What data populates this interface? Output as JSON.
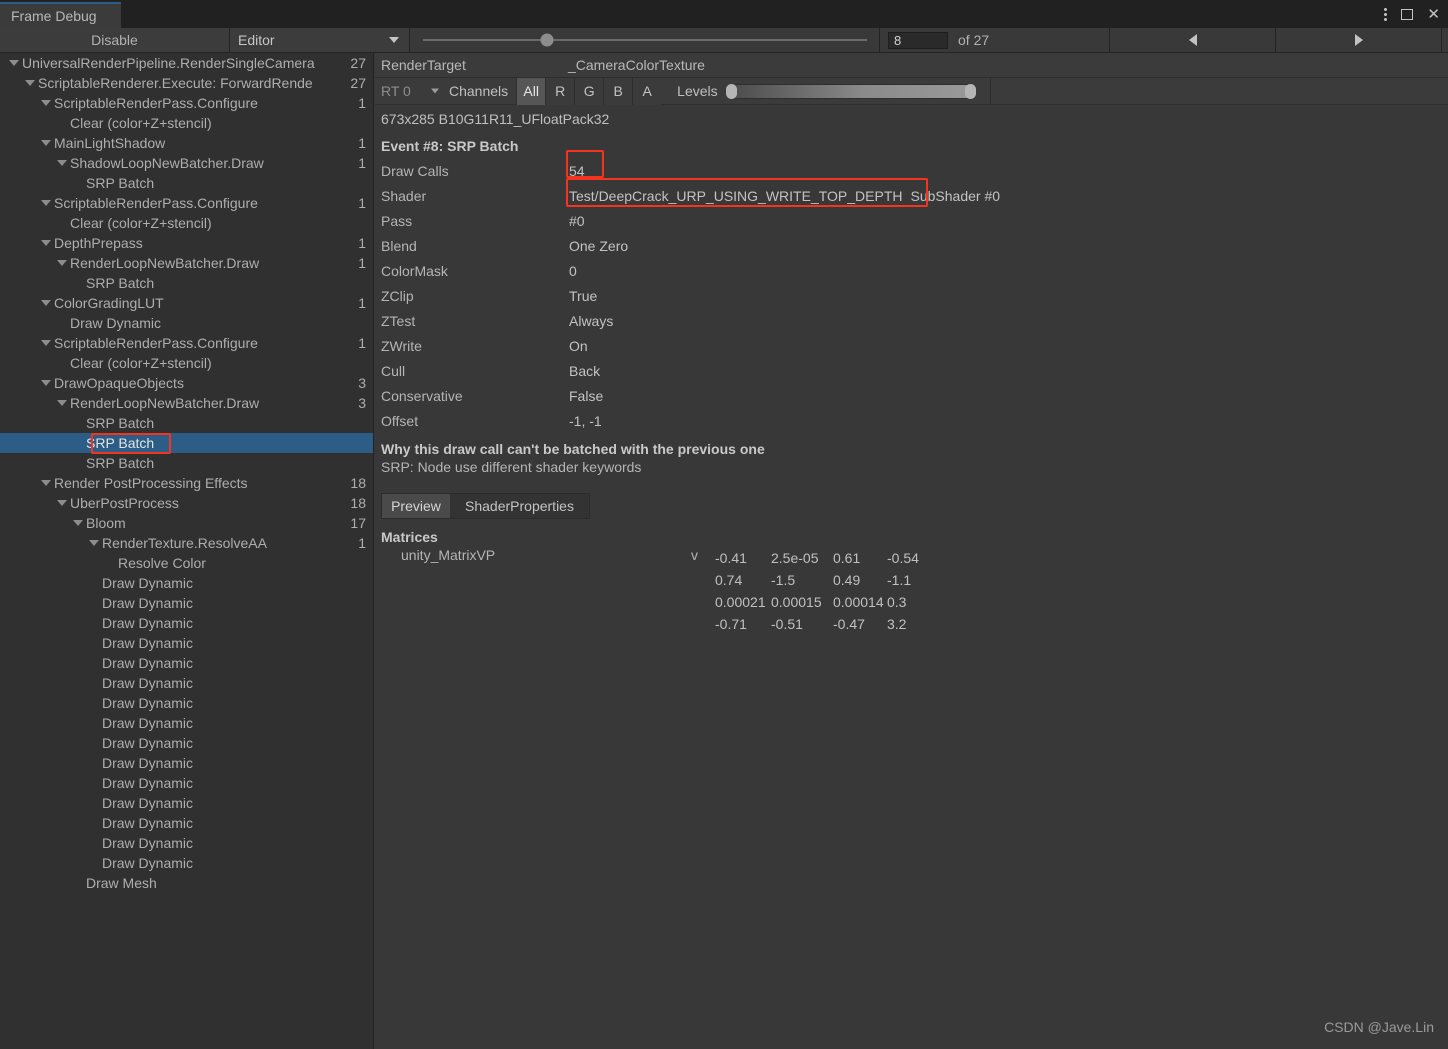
{
  "window": {
    "tab_title": "Frame Debug",
    "controls": {
      "menu": "kebab-icon",
      "maximize": "maximize-icon",
      "close": "✕"
    }
  },
  "toolbar": {
    "disable_label": "Disable",
    "target_dropdown": "Editor",
    "event_index": "8",
    "of_label": "of 27",
    "total_events": 27,
    "slider_percent": 28,
    "prev_label": "◀",
    "next_label": "▶"
  },
  "tree": {
    "rows": [
      {
        "label": "UniversalRenderPipeline.RenderSingleCamera",
        "depth": 0,
        "arrow": true,
        "count": "27"
      },
      {
        "label": "ScriptableRenderer.Execute: ForwardRende",
        "depth": 1,
        "arrow": true,
        "count": "27"
      },
      {
        "label": "ScriptableRenderPass.Configure",
        "depth": 2,
        "arrow": true,
        "count": "1"
      },
      {
        "label": "Clear (color+Z+stencil)",
        "depth": 3,
        "arrow": false,
        "count": ""
      },
      {
        "label": "MainLightShadow",
        "depth": 2,
        "arrow": true,
        "count": "1"
      },
      {
        "label": "ShadowLoopNewBatcher.Draw",
        "depth": 3,
        "arrow": true,
        "count": "1"
      },
      {
        "label": "SRP Batch",
        "depth": 4,
        "arrow": false,
        "count": ""
      },
      {
        "label": "ScriptableRenderPass.Configure",
        "depth": 2,
        "arrow": true,
        "count": "1"
      },
      {
        "label": "Clear (color+Z+stencil)",
        "depth": 3,
        "arrow": false,
        "count": ""
      },
      {
        "label": "DepthPrepass",
        "depth": 2,
        "arrow": true,
        "count": "1"
      },
      {
        "label": "RenderLoopNewBatcher.Draw",
        "depth": 3,
        "arrow": true,
        "count": "1"
      },
      {
        "label": "SRP Batch",
        "depth": 4,
        "arrow": false,
        "count": ""
      },
      {
        "label": "ColorGradingLUT",
        "depth": 2,
        "arrow": true,
        "count": "1"
      },
      {
        "label": "Draw Dynamic",
        "depth": 3,
        "arrow": false,
        "count": ""
      },
      {
        "label": "ScriptableRenderPass.Configure",
        "depth": 2,
        "arrow": true,
        "count": "1"
      },
      {
        "label": "Clear (color+Z+stencil)",
        "depth": 3,
        "arrow": false,
        "count": ""
      },
      {
        "label": "DrawOpaqueObjects",
        "depth": 2,
        "arrow": true,
        "count": "3"
      },
      {
        "label": "RenderLoopNewBatcher.Draw",
        "depth": 3,
        "arrow": true,
        "count": "3"
      },
      {
        "label": "SRP Batch",
        "depth": 4,
        "arrow": false,
        "count": ""
      },
      {
        "label": "SRP Batch",
        "depth": 4,
        "arrow": false,
        "count": "",
        "selected": true
      },
      {
        "label": "SRP Batch",
        "depth": 4,
        "arrow": false,
        "count": ""
      },
      {
        "label": "Render PostProcessing Effects",
        "depth": 2,
        "arrow": true,
        "count": "18"
      },
      {
        "label": "UberPostProcess",
        "depth": 3,
        "arrow": true,
        "count": "18"
      },
      {
        "label": "Bloom",
        "depth": 4,
        "arrow": true,
        "count": "17"
      },
      {
        "label": "RenderTexture.ResolveAA",
        "depth": 5,
        "arrow": true,
        "count": "1"
      },
      {
        "label": "Resolve Color",
        "depth": 6,
        "arrow": false,
        "count": ""
      },
      {
        "label": "Draw Dynamic",
        "depth": 5,
        "arrow": false,
        "count": ""
      },
      {
        "label": "Draw Dynamic",
        "depth": 5,
        "arrow": false,
        "count": ""
      },
      {
        "label": "Draw Dynamic",
        "depth": 5,
        "arrow": false,
        "count": ""
      },
      {
        "label": "Draw Dynamic",
        "depth": 5,
        "arrow": false,
        "count": ""
      },
      {
        "label": "Draw Dynamic",
        "depth": 5,
        "arrow": false,
        "count": ""
      },
      {
        "label": "Draw Dynamic",
        "depth": 5,
        "arrow": false,
        "count": ""
      },
      {
        "label": "Draw Dynamic",
        "depth": 5,
        "arrow": false,
        "count": ""
      },
      {
        "label": "Draw Dynamic",
        "depth": 5,
        "arrow": false,
        "count": ""
      },
      {
        "label": "Draw Dynamic",
        "depth": 5,
        "arrow": false,
        "count": ""
      },
      {
        "label": "Draw Dynamic",
        "depth": 5,
        "arrow": false,
        "count": ""
      },
      {
        "label": "Draw Dynamic",
        "depth": 5,
        "arrow": false,
        "count": ""
      },
      {
        "label": "Draw Dynamic",
        "depth": 5,
        "arrow": false,
        "count": ""
      },
      {
        "label": "Draw Dynamic",
        "depth": 5,
        "arrow": false,
        "count": ""
      },
      {
        "label": "Draw Dynamic",
        "depth": 5,
        "arrow": false,
        "count": ""
      },
      {
        "label": "Draw Dynamic",
        "depth": 5,
        "arrow": false,
        "count": ""
      },
      {
        "label": "Draw Mesh",
        "depth": 4,
        "arrow": false,
        "count": ""
      }
    ]
  },
  "detail": {
    "render_target_label": "RenderTarget",
    "render_target_value": "_CameraColorTexture",
    "rt_select": "RT 0",
    "channels_label": "Channels",
    "channels": [
      "All",
      "R",
      "G",
      "B",
      "A"
    ],
    "channel_active": "All",
    "levels_label": "Levels",
    "rt_info": "673x285 B10G11R11_UFloatPack32",
    "event_title": "Event #8: SRP Batch",
    "properties": [
      {
        "key": "Draw Calls",
        "value": "54"
      },
      {
        "key": "Shader",
        "value": "Test/DeepCrack_URP_USING_WRITE_TOP_DEPTH",
        "value2": "SubShader #0"
      },
      {
        "key": "Pass",
        "value": "#0"
      },
      {
        "key": "Blend",
        "value": "One Zero"
      },
      {
        "key": "ColorMask",
        "value": "0"
      },
      {
        "key": "ZClip",
        "value": "True"
      },
      {
        "key": "ZTest",
        "value": "Always"
      },
      {
        "key": "ZWrite",
        "value": "On"
      },
      {
        "key": "Cull",
        "value": "Back"
      },
      {
        "key": "Conservative",
        "value": "False"
      },
      {
        "key": "Offset",
        "value": "-1, -1"
      }
    ],
    "why_title": "Why this draw call can't be batched with the previous one",
    "why_body": "SRP: Node use different shader keywords",
    "tabs": {
      "preview": "Preview",
      "shader_properties": "ShaderProperties",
      "active": "Preview"
    },
    "matrices_title": "Matrices",
    "matrix_name": "unity_MatrixVP",
    "matrix_v": "v",
    "matrix_values": [
      "-0.41",
      "2.5e-05",
      "0.61",
      "-0.54",
      "0.74",
      "-1.5",
      "0.49",
      "-1.1",
      "0.00021",
      "0.00015",
      "0.00014",
      "0.3",
      "-0.71",
      "-0.51",
      "-0.47",
      "3.2"
    ]
  },
  "annotations": {
    "color": "#f4341f",
    "boxes": [
      "draw-calls-value",
      "shader-value",
      "selected-tree-row"
    ]
  },
  "watermark": "CSDN @Jave.Lin"
}
